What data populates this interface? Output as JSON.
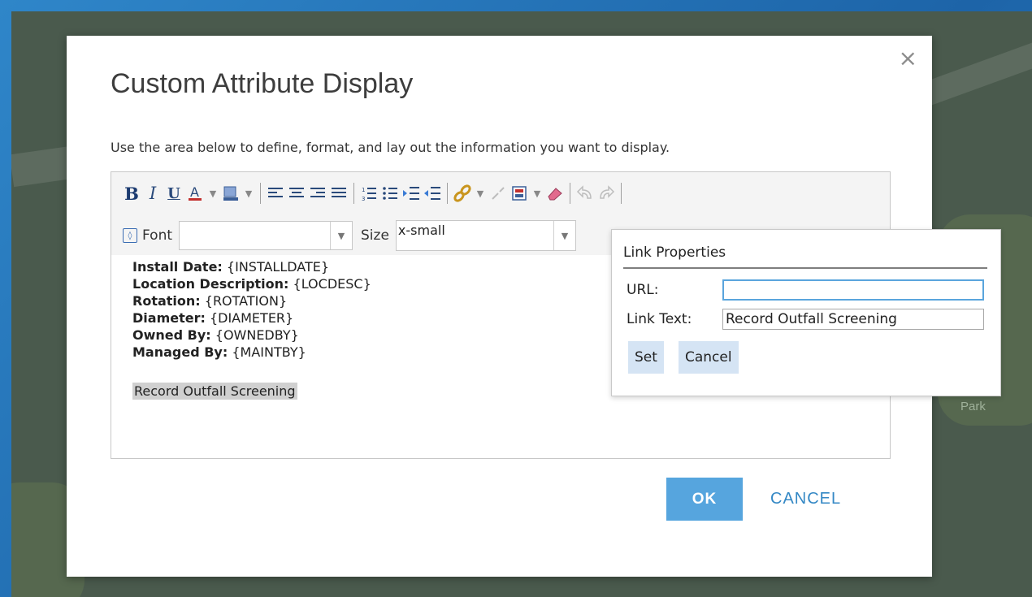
{
  "dialog": {
    "title": "Custom Attribute Display",
    "description": "Use the area below to define, format, and lay out the information you want to display.",
    "close_glyph": "×",
    "ok_label": "OK",
    "cancel_label": "CANCEL"
  },
  "map": {
    "label": "Park"
  },
  "toolbar": {
    "font_label": "Font",
    "font_value": "",
    "size_label": "Size",
    "size_value": "x-small",
    "icons": [
      "bold-icon",
      "italic-icon",
      "underline-icon",
      "font-color-icon",
      "highlight-color-icon",
      "align-left-icon",
      "align-center-icon",
      "align-right-icon",
      "justify-icon",
      "numbered-list-icon",
      "bulleted-list-icon",
      "indent-icon",
      "outdent-icon",
      "link-icon",
      "unlink-icon",
      "insert-field-icon",
      "eraser-icon",
      "undo-icon",
      "redo-icon",
      "view-source-icon"
    ]
  },
  "content": {
    "rows": [
      {
        "label": "Install Date:",
        "value": " {INSTALLDATE}"
      },
      {
        "label": "Location Description:",
        "value": " {LOCDESC}"
      },
      {
        "label": "Rotation:",
        "value": " {ROTATION}"
      },
      {
        "label": "Diameter:",
        "value": " {DIAMETER}"
      },
      {
        "label": "Owned By:",
        "value": " {OWNEDBY}"
      },
      {
        "label": "Managed By:",
        "value": " {MAINTBY}"
      }
    ],
    "selected_link_text": "Record Outfall Screening"
  },
  "link_popup": {
    "title": "Link Properties",
    "url_label": "URL:",
    "url_value": "",
    "link_text_label": "Link Text:",
    "link_text_value": "Record Outfall Screening",
    "set_label": "Set",
    "cancel_label": "Cancel"
  },
  "colors": {
    "accent": "#56a5de",
    "link": "#3488c5",
    "popup_button": "#d5e4f4"
  }
}
